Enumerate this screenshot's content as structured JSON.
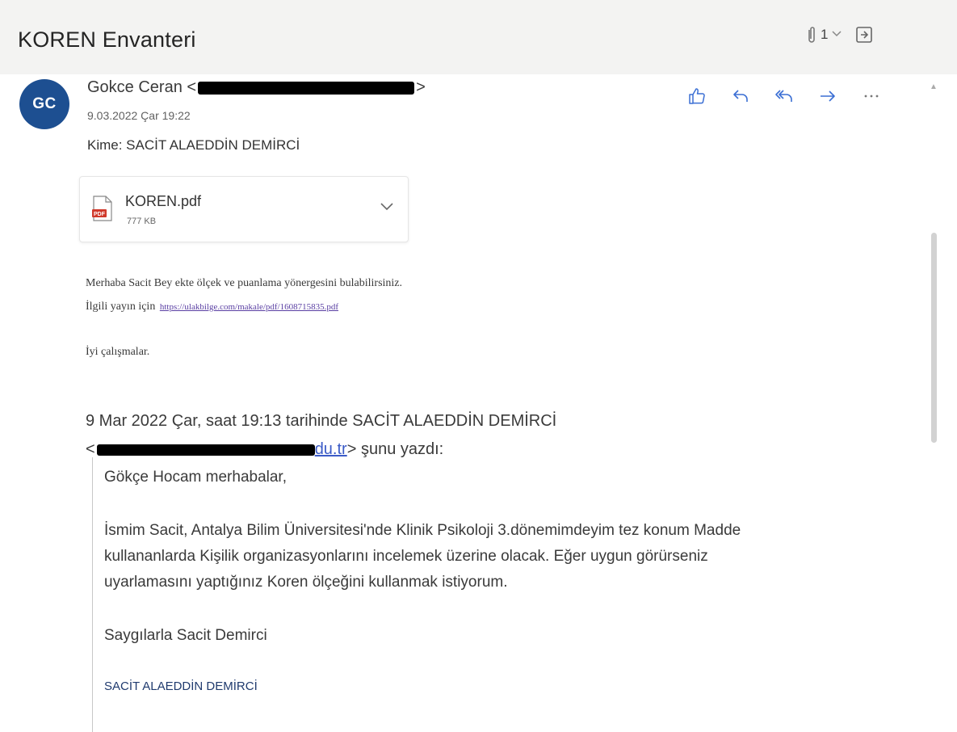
{
  "header": {
    "subject": "KOREN Envanteri",
    "attachment_count": "1"
  },
  "message": {
    "avatar_initials": "GC",
    "sender_name": "Gokce Ceran <",
    "sender_suffix": ">",
    "datetime": "9.03.2022 Çar 19:22",
    "to_line": "Kime: SACİT ALAEDDİN DEMİRCİ",
    "attachment": {
      "filename": "KOREN.pdf",
      "size": "777 KB"
    },
    "body": {
      "line1": "Merhaba Sacit Bey ekte ölçek ve puanlama yönergesini bulabilirsiniz.",
      "line2_prefix": "İlgili yayın için",
      "line2_link": "https://ulakbilge.com/makale/pdf/1608715835.pdf",
      "line3": "İyi çalışmalar."
    }
  },
  "quoted": {
    "header_line1": "9 Mar 2022 Çar, saat 19:13 tarihinde SACİT ALAEDDİN DEMİRCİ",
    "header_lt": "<",
    "header_link_tail": "du.tr",
    "header_tail": "> şunu yazdı:",
    "greeting": "Gökçe Hocam merhabalar,",
    "p1": "İsmim Sacit, Antalya Bilim Üniversitesi'nde Klinik Psikoloji 3.dönemimdeyim tez konum Madde",
    "p2": "kullananlarda Kişilik organizasyonlarını incelemek üzerine olacak. Eğer uygun görürseniz",
    "p3": "uyarlamasını yaptığınız Koren ölçeğini kullanmak istiyorum.",
    "signoff": "Saygılarla Sacit Demirci",
    "signature": "SACİT ALAEDDİN DEMİRCİ"
  },
  "icons": {
    "attachment": "paperclip-icon",
    "expand": "chevron-down-icon",
    "popout": "open-in-new-window-icon",
    "like": "thumbs-up-icon",
    "reply": "reply-icon",
    "reply_all": "reply-all-icon",
    "forward": "forward-icon",
    "more": "more-icon",
    "pdf": "pdf-file-icon"
  },
  "colors": {
    "avatar_bg": "#1d4f91",
    "action_icon": "#3b6fd4",
    "pdf_red": "#d0392b",
    "link": "#5a3fa3"
  }
}
